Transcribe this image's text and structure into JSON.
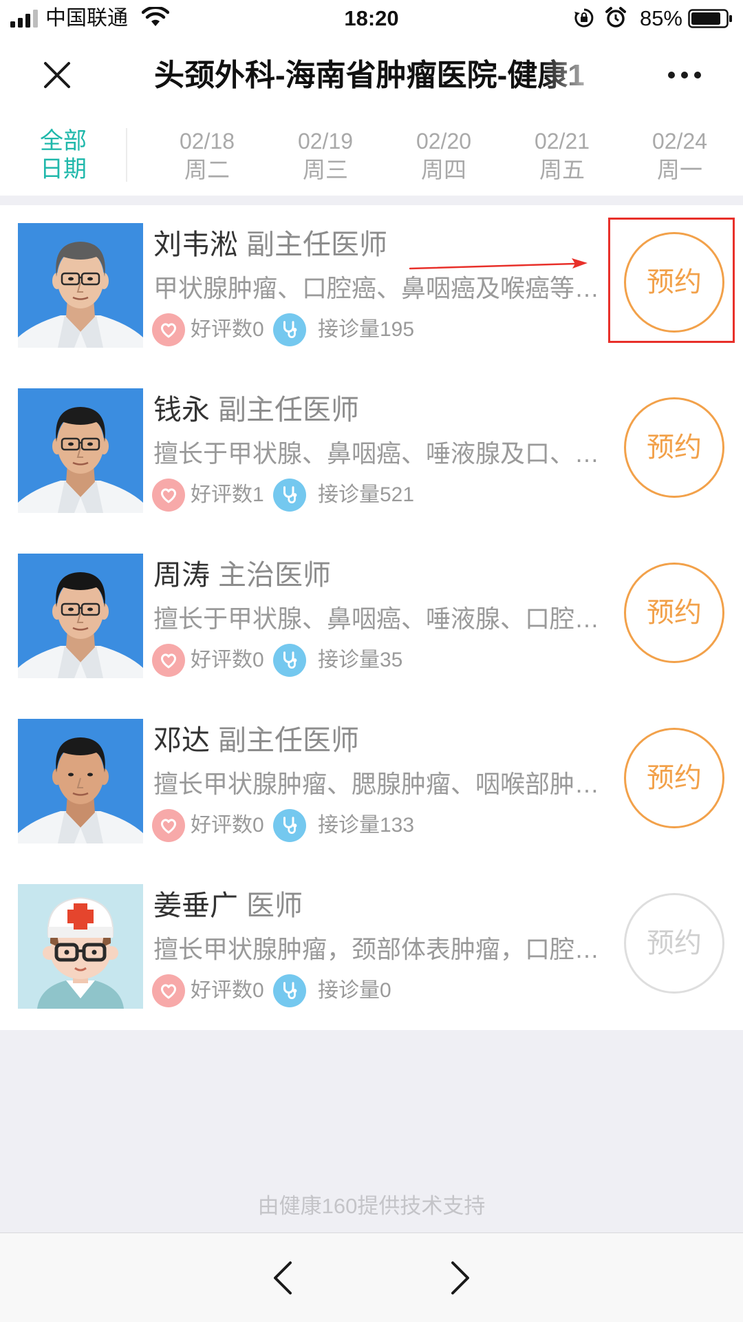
{
  "status_bar": {
    "carrier": "中国联通",
    "time": "18:20",
    "battery": "85%",
    "icons": [
      "signal-icon",
      "wifi-icon",
      "rotation-lock-icon",
      "alarm-icon",
      "battery-icon"
    ]
  },
  "nav": {
    "title": "头颈外科-海南省肿瘤医院-健康1",
    "close_icon": "close-icon",
    "more_icon": "more-icon"
  },
  "date_tabs": {
    "all": {
      "line1": "全部",
      "line2": "日期"
    },
    "dates": [
      {
        "date": "02/18",
        "weekday": "周二"
      },
      {
        "date": "02/19",
        "weekday": "周三"
      },
      {
        "date": "02/20",
        "weekday": "周四"
      },
      {
        "date": "02/21",
        "weekday": "周五"
      },
      {
        "date": "02/24",
        "weekday": "周一"
      }
    ]
  },
  "doctors": [
    {
      "name": "刘韦淞",
      "title": "副主任医师",
      "specialty": "甲状腺肿瘤、口腔癌、鼻咽癌及喉癌等…",
      "rating": "好评数0",
      "visits": "接诊量195",
      "book_label": "预约",
      "available": true,
      "avatar": "doctor-photo"
    },
    {
      "name": "钱永",
      "title": "副主任医师",
      "specialty": "擅长于甲状腺、鼻咽癌、唾液腺及口、…",
      "rating": "好评数1",
      "visits": "接诊量521",
      "book_label": "预约",
      "available": true,
      "avatar": "doctor-photo"
    },
    {
      "name": "周涛",
      "title": "主治医师",
      "specialty": "擅长于甲状腺、鼻咽癌、唾液腺、口腔…",
      "rating": "好评数0",
      "visits": "接诊量35",
      "book_label": "预约",
      "available": true,
      "avatar": "doctor-photo"
    },
    {
      "name": "邓达",
      "title": "副主任医师",
      "specialty": "擅长甲状腺肿瘤、腮腺肿瘤、咽喉部肿…",
      "rating": "好评数0",
      "visits": "接诊量133",
      "book_label": "预约",
      "available": true,
      "avatar": "doctor-photo"
    },
    {
      "name": "姜垂广",
      "title": "医师",
      "specialty": "擅长甲状腺肿瘤，颈部体表肿瘤，口腔…",
      "rating": "好评数0",
      "visits": "接诊量0",
      "book_label": "预约",
      "available": false,
      "avatar": "cartoon-doctor-avatar"
    }
  ],
  "footer": {
    "text": "由健康160提供技术支持"
  },
  "toolbar": {
    "back_icon": "chevron-left-icon",
    "forward_icon": "chevron-right-icon"
  },
  "colors": {
    "accent_teal": "#20b8ab",
    "book_orange": "#f2a14a",
    "disabled_gray": "#cfcfcf",
    "annotation_red": "#e8302a",
    "rating_pink": "#f7a9a9",
    "visits_blue": "#74c8ef"
  }
}
